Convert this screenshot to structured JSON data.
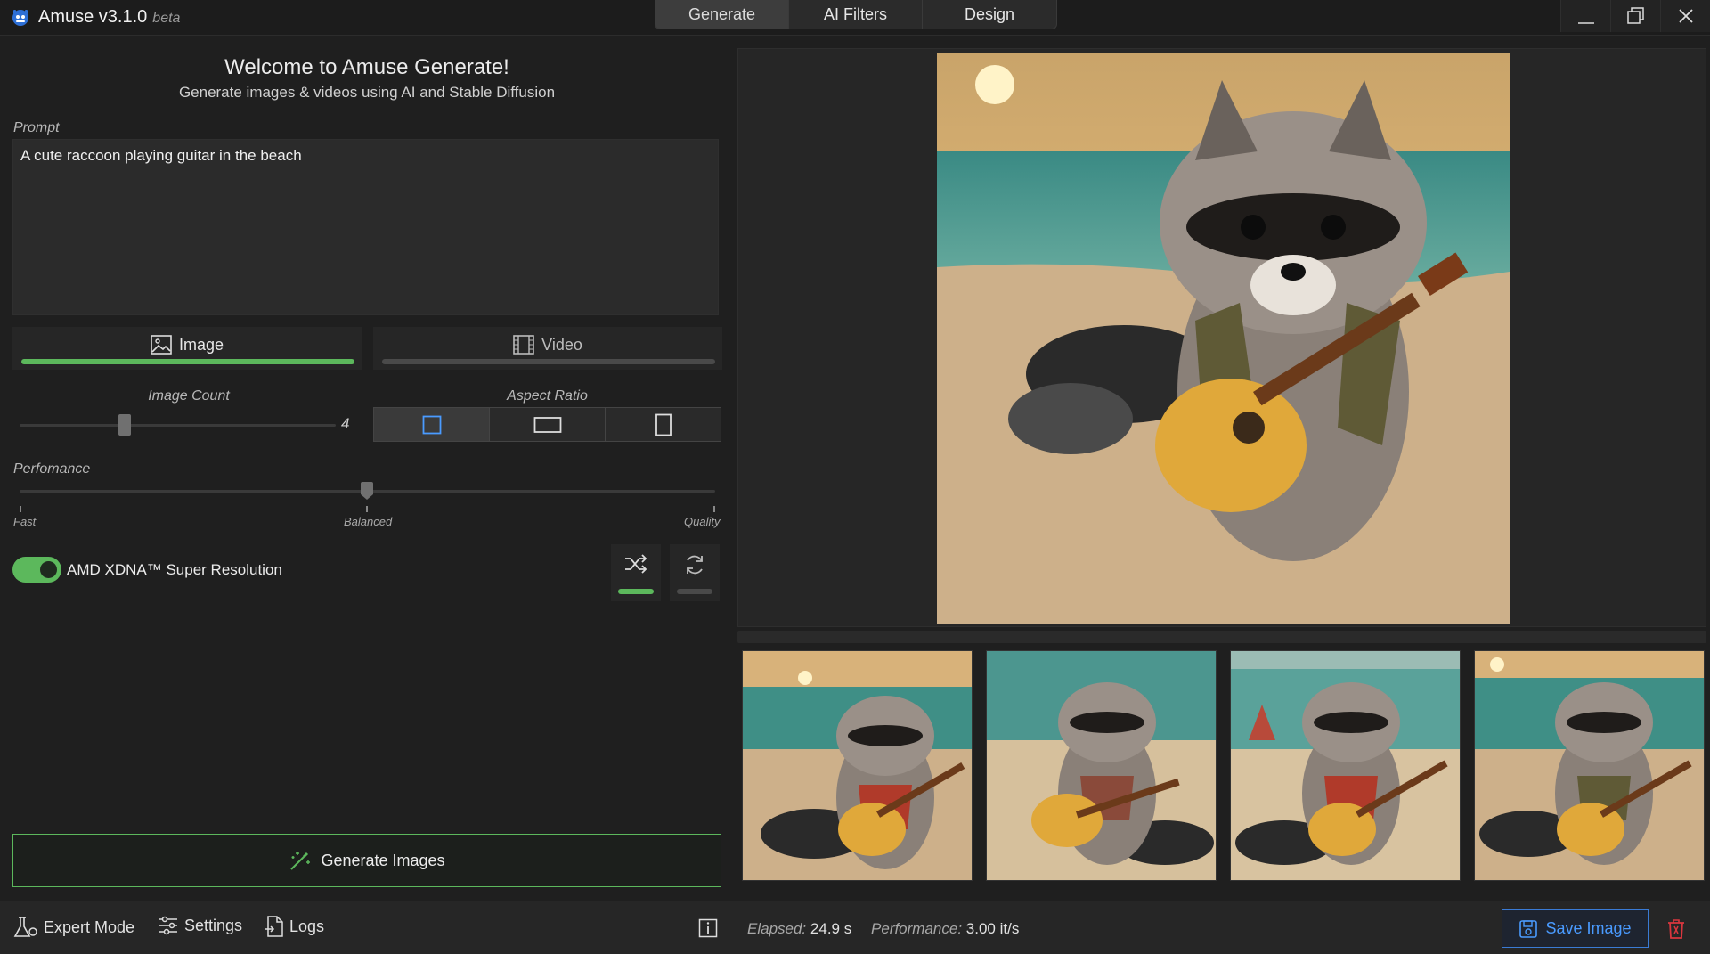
{
  "app": {
    "name": "Amuse v3.1.0",
    "badge": "beta"
  },
  "top_tabs": [
    "Generate",
    "AI Filters",
    "Design"
  ],
  "welcome": {
    "title": "Welcome to Amuse Generate!",
    "subtitle": "Generate images & videos using AI and Stable Diffusion"
  },
  "prompt": {
    "label": "Prompt",
    "value": "A cute raccoon playing guitar in the beach"
  },
  "mode_tabs": {
    "image": "Image",
    "video": "Video"
  },
  "image_count": {
    "label": "Image Count",
    "value": "4"
  },
  "aspect_ratio": {
    "label": "Aspect Ratio",
    "options": [
      "square",
      "landscape",
      "portrait"
    ],
    "selected": "square"
  },
  "performance": {
    "label": "Perfomance",
    "fast": "Fast",
    "balanced": "Balanced",
    "quality": "Quality",
    "level": 0.5
  },
  "super_resolution": {
    "label": "AMD XDNA™ Super Resolution",
    "enabled": true
  },
  "generate_button": "Generate Images",
  "bottom": {
    "expert_mode": "Expert Mode",
    "settings": "Settings",
    "logs": "Logs",
    "elapsed_label": "Elapsed:",
    "elapsed_value": "24.9 s",
    "performance_label": "Performance:",
    "performance_value": "3.00 it/s",
    "save_image": "Save Image"
  },
  "colors": {
    "accent_green": "#5cb85c",
    "accent_blue": "#4a9bff",
    "delete_red": "#d9363e"
  }
}
